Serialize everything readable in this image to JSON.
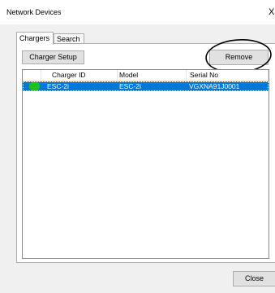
{
  "window": {
    "title": "Network Devices",
    "close_glyph": "X"
  },
  "tabs": [
    {
      "label": "Chargers",
      "active": true
    },
    {
      "label": "Search",
      "active": false
    }
  ],
  "toolbar": {
    "charger_setup_label": "Charger Setup",
    "remove_label": "Remove"
  },
  "table": {
    "columns": [
      "",
      "Charger ID",
      "Model",
      "Serial No"
    ],
    "rows": [
      {
        "status": "online",
        "status_color": "#1ec21e",
        "charger_id": "ESC-2i",
        "model": "ESC-2i",
        "serial_no": "VGXNA91J0001",
        "selected": true
      }
    ]
  },
  "footer": {
    "close_label": "Close"
  },
  "colors": {
    "selection": "#0078d7",
    "status_online": "#1ec21e",
    "annotation_circle": "#000000"
  },
  "icons": {
    "window_close": "close-icon",
    "row_status": "status-dot-icon"
  }
}
